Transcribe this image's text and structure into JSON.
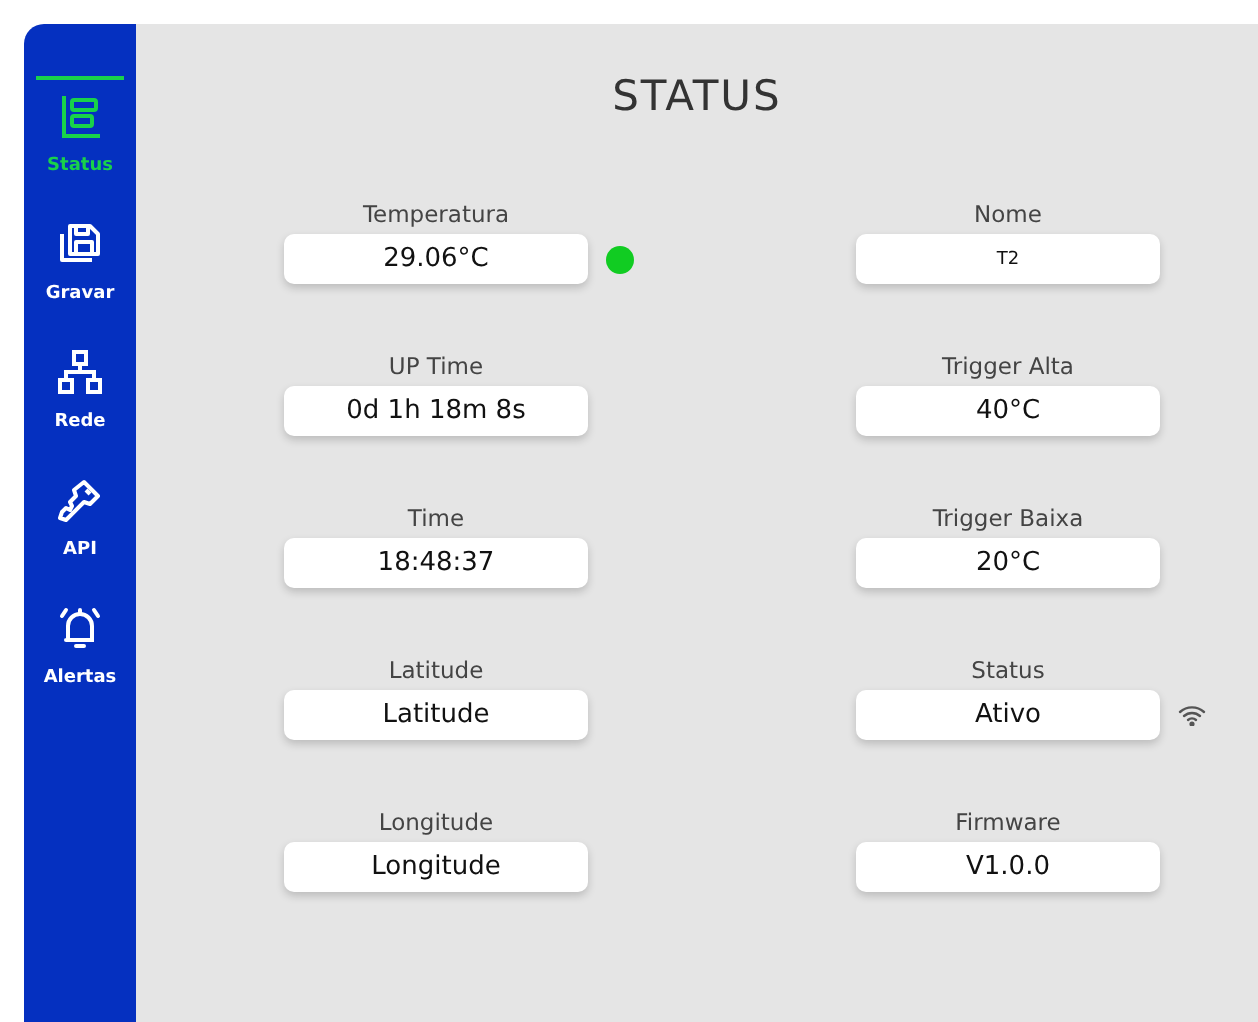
{
  "sidebar": {
    "items": [
      {
        "label": "Status",
        "selected": true
      },
      {
        "label": "Gravar",
        "selected": false
      },
      {
        "label": "Rede",
        "selected": false
      },
      {
        "label": "API",
        "selected": false
      },
      {
        "label": "Alertas",
        "selected": false
      }
    ]
  },
  "title": "STATUS",
  "columns": [
    [
      {
        "label": "Temperatura",
        "value": "29.06°C",
        "badge": {
          "kind": "dot",
          "color": "#11cc22"
        }
      },
      {
        "label": "UP Time",
        "value": "0d 1h 18m 8s"
      },
      {
        "label": "Time",
        "value": "18:48:37"
      },
      {
        "label": "Latitude",
        "value": "Latitude"
      },
      {
        "label": "Longitude",
        "value": "Longitude"
      }
    ],
    [
      {
        "label": "Nome",
        "value": "T2",
        "small": true
      },
      {
        "label": "Trigger Alta",
        "value": "40°C"
      },
      {
        "label": "Trigger Baixa",
        "value": "20°C"
      },
      {
        "label": "Status",
        "value": "Ativo",
        "badge": {
          "kind": "wifi"
        }
      },
      {
        "label": "Firmware",
        "value": "V1.0.0"
      }
    ]
  ]
}
